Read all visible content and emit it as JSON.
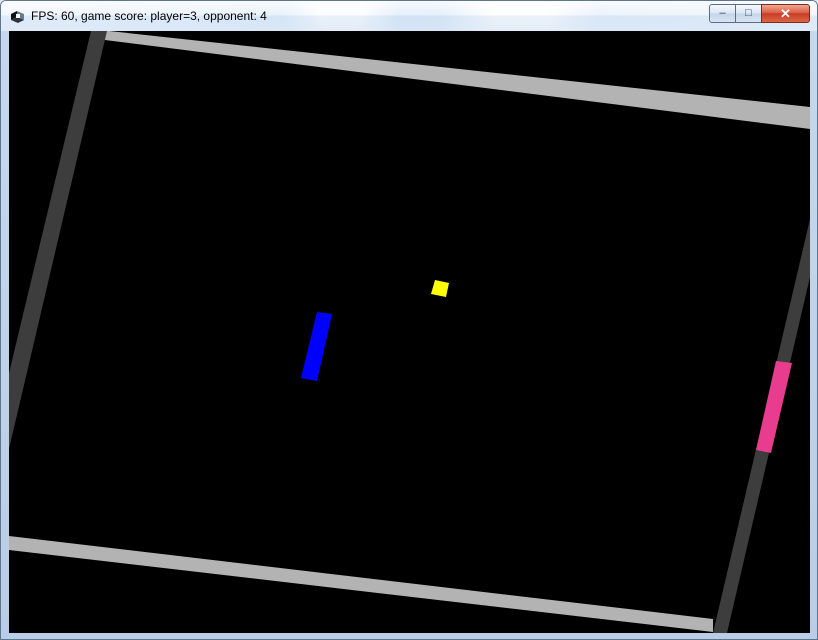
{
  "window": {
    "title": "FPS: 60, game score: player=3, opponent: 4",
    "caption_buttons": {
      "minimize": "–",
      "maximize": "□",
      "close": "✕"
    }
  },
  "game": {
    "fps": 60,
    "score": {
      "player": 3,
      "opponent": 4
    },
    "colors": {
      "background": "#000000",
      "top_wall": "#b3b3b3",
      "bottom_wall": "#b3b3b3",
      "left_wall": "#3d3d3d",
      "right_wall": "#3d3d3d",
      "player_paddle": "#0000ff",
      "opponent_paddle": "#e83c8f",
      "ball": "#ffff00"
    }
  }
}
